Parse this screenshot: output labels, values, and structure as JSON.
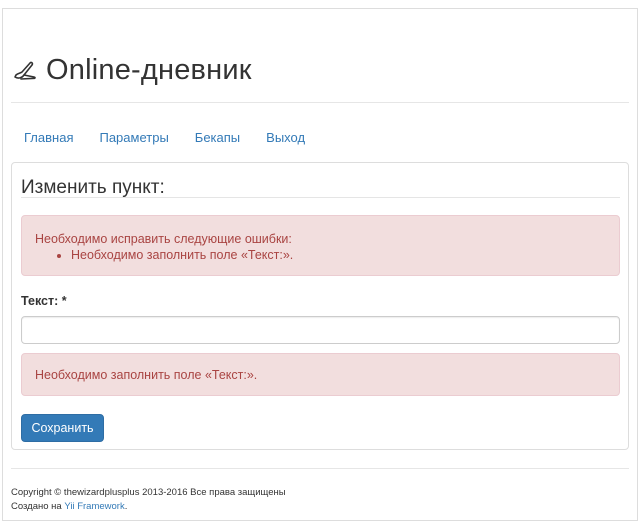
{
  "site": {
    "title": "Online-дневник",
    "logo_icon": "diary-pen-icon"
  },
  "nav": {
    "items": [
      {
        "label": "Главная"
      },
      {
        "label": "Параметры"
      },
      {
        "label": "Бекапы"
      },
      {
        "label": "Выход"
      }
    ]
  },
  "form": {
    "title": "Изменить пункт:",
    "error_summary": {
      "title": "Необходимо исправить следующие ошибки:",
      "items": [
        "Необходимо заполнить поле «Текст:»."
      ]
    },
    "text_field": {
      "label": "Текст: *",
      "value": "",
      "error": "Необходимо заполнить поле «Текст:»."
    },
    "save_label": "Сохранить"
  },
  "footer": {
    "copyright": "Copyright © thewizardplusplus 2013-2016 Все права защищены",
    "created_prefix": "Создано на ",
    "framework_link": "Yii Framework",
    "created_suffix": "."
  },
  "colors": {
    "link": "#337ab7",
    "error_bg": "#f2dede",
    "error_text": "#a94442",
    "primary": "#337ab7"
  }
}
